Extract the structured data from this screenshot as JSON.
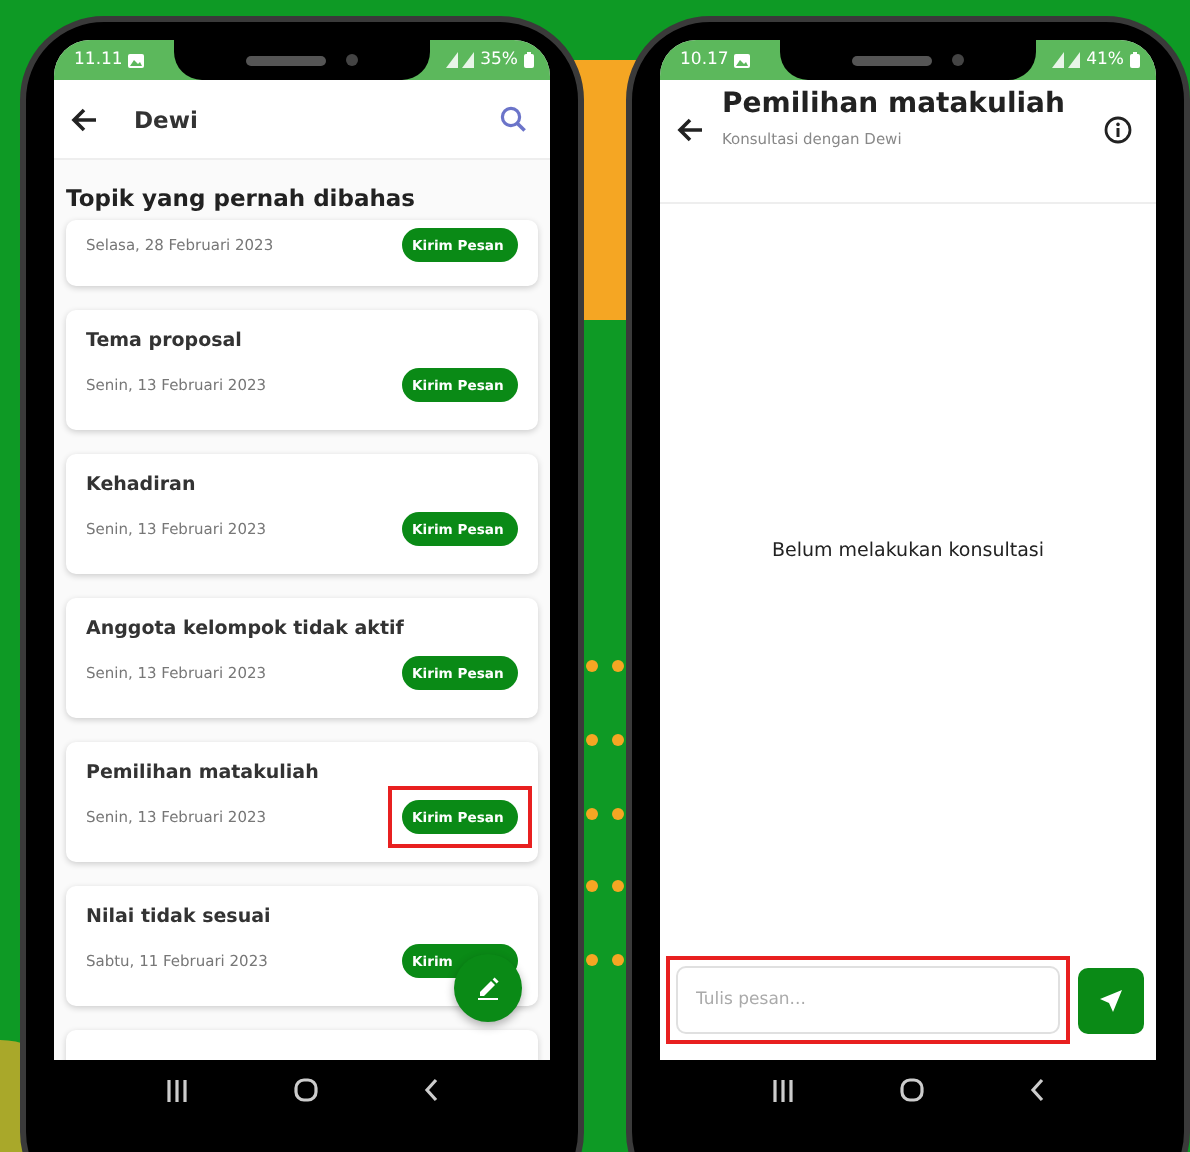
{
  "phones": [
    {
      "kind": "topic_list",
      "status_bar": {
        "time": "11.11",
        "battery": "35%"
      },
      "app_bar": {
        "title": "Dewi"
      },
      "section_title": "Topik yang pernah dibahas",
      "topics": [
        {
          "date": "Selasa, 28 Februari 2023",
          "button": "Kirim Pesan",
          "highlighted": false
        },
        {
          "title": "Tema proposal",
          "date": "Senin, 13 Februari 2023",
          "button": "Kirim Pesan",
          "highlighted": false
        },
        {
          "title": "Kehadiran",
          "date": "Senin, 13 Februari 2023",
          "button": "Kirim Pesan",
          "highlighted": false
        },
        {
          "title": "Anggota kelompok tidak aktif",
          "date": "Senin, 13 Februari 2023",
          "button": "Kirim Pesan",
          "highlighted": false
        },
        {
          "title": "Pemilihan matakuliah",
          "date": "Senin, 13 Februari 2023",
          "button": "Kirim Pesan",
          "highlighted": true
        },
        {
          "title": "Nilai tidak sesuai",
          "date": "Sabtu, 11 Februari 2023",
          "button": "Kirim",
          "highlighted": false
        }
      ]
    },
    {
      "kind": "chat",
      "status_bar": {
        "time": "10.17",
        "battery": "41%"
      },
      "app_bar": {
        "title": "Pemilihan matakuliah",
        "subtitle": "Konsultasi dengan Dewi"
      },
      "empty_message": "Belum melakukan konsultasi",
      "composer": {
        "placeholder": "Tulis pesan...",
        "highlighted": true
      }
    }
  ]
}
